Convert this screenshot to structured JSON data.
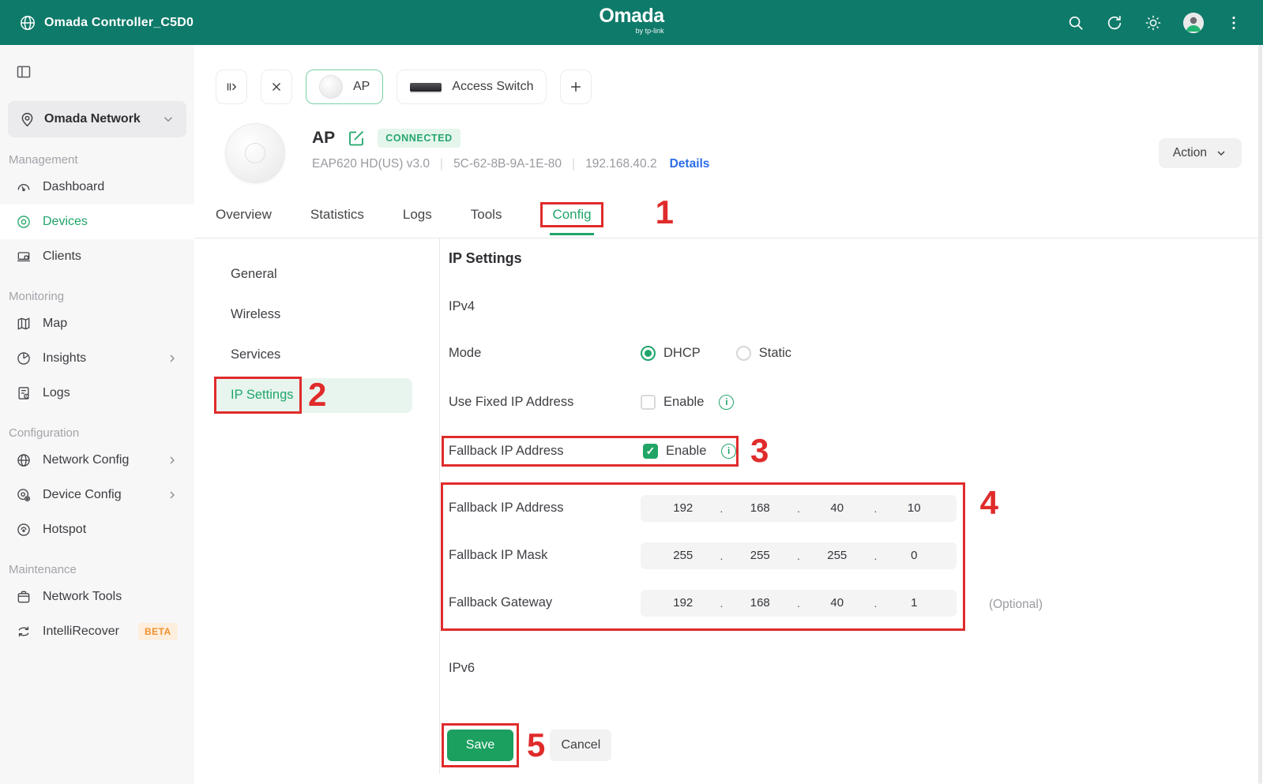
{
  "colors": {
    "header_teal": "#0e7a6a",
    "accent_green": "#21a56a",
    "light_green_bg": "#e7f5ee",
    "annotation_red": "#e02b2b",
    "link_blue": "#2b6de8",
    "beta_orange": "#f0912f",
    "field_gray": "#f4f4f5",
    "status_green_bg": "#e4f6ec"
  },
  "header": {
    "title": "Omada Controller_C5D0",
    "logo_text": "Omada",
    "logo_subtext": "by tp-link",
    "icons": [
      "globe-icon",
      "search-icon",
      "refresh-icon",
      "brightness-icon",
      "account-avatar",
      "more-menu-icon"
    ]
  },
  "sidebar": {
    "collapse_icon": "panel-collapse-icon",
    "site_selector_label": "Omada Network",
    "sections": [
      {
        "label": "Management",
        "items": [
          {
            "label": "Dashboard",
            "icon": "dashboard-icon"
          },
          {
            "label": "Devices",
            "icon": "devices-icon",
            "active": true
          },
          {
            "label": "Clients",
            "icon": "clients-icon"
          }
        ]
      },
      {
        "label": "Monitoring",
        "items": [
          {
            "label": "Map",
            "icon": "map-icon"
          },
          {
            "label": "Insights",
            "icon": "insights-icon",
            "has_submenu": true
          },
          {
            "label": "Logs",
            "icon": "logs-icon"
          }
        ]
      },
      {
        "label": "Configuration",
        "items": [
          {
            "label": "Network Config",
            "icon": "network-config-icon",
            "has_submenu": true
          },
          {
            "label": "Device Config",
            "icon": "device-config-icon",
            "has_submenu": true
          },
          {
            "label": "Hotspot",
            "icon": "hotspot-icon"
          }
        ]
      },
      {
        "label": "Maintenance",
        "items": [
          {
            "label": "Network Tools",
            "icon": "network-tools-icon"
          },
          {
            "label": "IntelliRecover",
            "icon": "intellirecover-icon",
            "badge": "BETA"
          }
        ]
      }
    ]
  },
  "device_switcher": {
    "tabs": [
      {
        "label": "AP",
        "selected": true,
        "icon": "ap-device-image"
      },
      {
        "label": "Access Switch",
        "selected": false,
        "icon": "switch-device-image"
      }
    ]
  },
  "device_header": {
    "name": "AP",
    "status_badge": "CONNECTED",
    "model": "EAP620 HD(US) v3.0",
    "mac": "5C-62-8B-9A-1E-80",
    "ip": "192.168.40.2",
    "meta_separator": "|",
    "details_link": "Details",
    "action_button": "Action"
  },
  "tabs": [
    {
      "label": "Overview"
    },
    {
      "label": "Statistics"
    },
    {
      "label": "Logs"
    },
    {
      "label": "Tools"
    },
    {
      "label": "Config",
      "active": true
    }
  ],
  "config_nav": [
    {
      "label": "General"
    },
    {
      "label": "Wireless"
    },
    {
      "label": "Services"
    },
    {
      "label": "IP Settings",
      "active": true
    }
  ],
  "ip_settings": {
    "title": "IP Settings",
    "ipv4_label": "IPv4",
    "mode": {
      "label": "Mode",
      "options": [
        "DHCP",
        "Static"
      ],
      "selected": "DHCP"
    },
    "use_fixed_ip": {
      "label": "Use Fixed IP Address",
      "checkbox_label": "Enable",
      "checked": false
    },
    "fallback_toggle": {
      "label": "Fallback IP Address",
      "checkbox_label": "Enable",
      "checked": true,
      "checkmark": "✓"
    },
    "octet_separator": ".",
    "fallback_fields": [
      {
        "label": "Fallback IP Address",
        "octets": [
          "192",
          "168",
          "40",
          "10"
        ]
      },
      {
        "label": "Fallback IP Mask",
        "octets": [
          "255",
          "255",
          "255",
          "0"
        ]
      },
      {
        "label": "Fallback Gateway",
        "octets": [
          "192",
          "168",
          "40",
          "1"
        ],
        "note": "(Optional)"
      }
    ],
    "ipv6_label": "IPv6",
    "save_button": "Save",
    "cancel_button": "Cancel"
  },
  "annotations": {
    "step1": "1",
    "step2": "2",
    "step3": "3",
    "step4": "4",
    "step5": "5"
  }
}
